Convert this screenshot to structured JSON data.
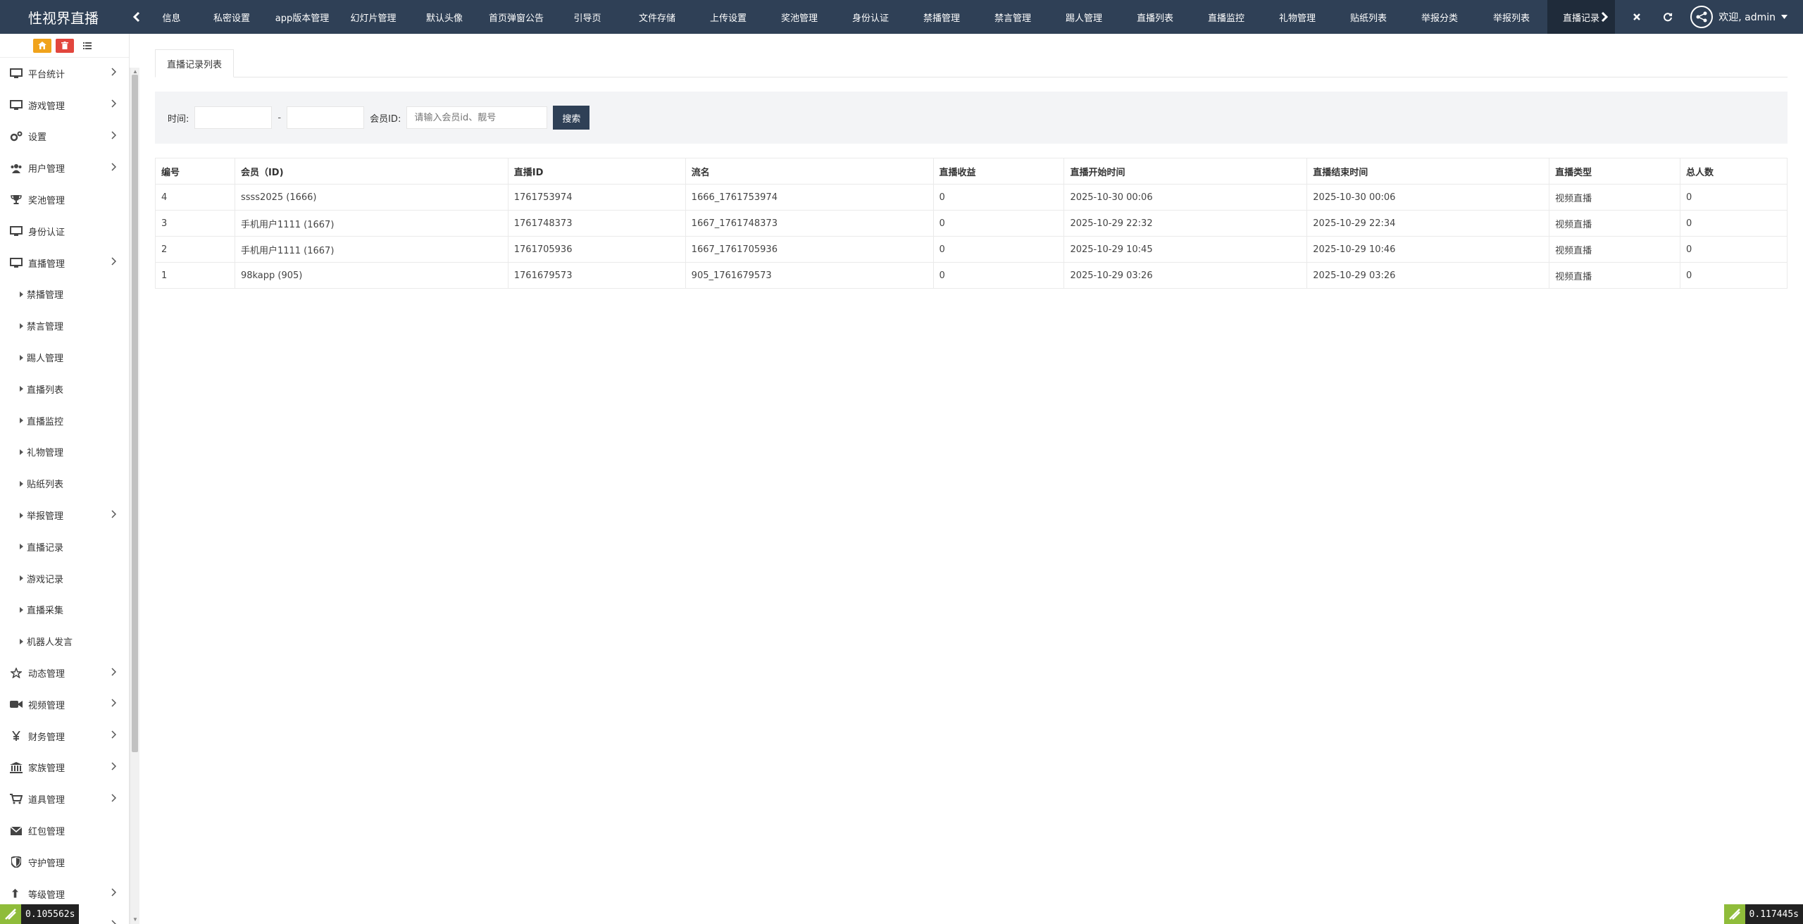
{
  "app": {
    "title": "性视界直播"
  },
  "topnav": [
    "信息",
    "私密设置",
    "app版本管理",
    "幻灯片管理",
    "默认头像",
    "首页弹窗公告",
    "引导页",
    "文件存储",
    "上传设置",
    "奖池管理",
    "身份认证",
    "禁播管理",
    "禁言管理",
    "踢人管理",
    "直播列表",
    "直播监控",
    "礼物管理",
    "贴纸列表",
    "举报分类",
    "举报列表",
    "直播记录"
  ],
  "topnav_active": "直播记录",
  "user": {
    "welcome": "欢迎, admin"
  },
  "sidebar": {
    "items": [
      {
        "label": "平台统计",
        "icon": "monitor-icon",
        "sub": false,
        "chevron": true
      },
      {
        "label": "游戏管理",
        "icon": "monitor-icon",
        "sub": false,
        "chevron": true
      },
      {
        "label": "设置",
        "icon": "cogs-icon",
        "sub": false,
        "chevron": true
      },
      {
        "label": "用户管理",
        "icon": "users-icon",
        "sub": false,
        "chevron": true
      },
      {
        "label": "奖池管理",
        "icon": "trophy-icon",
        "sub": false,
        "chevron": false
      },
      {
        "label": "身份认证",
        "icon": "monitor-icon",
        "sub": false,
        "chevron": false
      },
      {
        "label": "直播管理",
        "icon": "monitor-icon",
        "sub": false,
        "chevron": true,
        "expanded": true
      },
      {
        "label": "禁播管理",
        "icon": "caret-right-icon",
        "sub": true,
        "chevron": false
      },
      {
        "label": "禁言管理",
        "icon": "caret-right-icon",
        "sub": true,
        "chevron": false
      },
      {
        "label": "踢人管理",
        "icon": "caret-right-icon",
        "sub": true,
        "chevron": false
      },
      {
        "label": "直播列表",
        "icon": "caret-right-icon",
        "sub": true,
        "chevron": false
      },
      {
        "label": "直播监控",
        "icon": "caret-right-icon",
        "sub": true,
        "chevron": false
      },
      {
        "label": "礼物管理",
        "icon": "caret-right-icon",
        "sub": true,
        "chevron": false
      },
      {
        "label": "贴纸列表",
        "icon": "caret-right-icon",
        "sub": true,
        "chevron": false
      },
      {
        "label": "举报管理",
        "icon": "caret-right-icon",
        "sub": true,
        "chevron": true
      },
      {
        "label": "直播记录",
        "icon": "caret-right-icon",
        "sub": true,
        "chevron": false
      },
      {
        "label": "游戏记录",
        "icon": "caret-right-icon",
        "sub": true,
        "chevron": false
      },
      {
        "label": "直播采集",
        "icon": "caret-right-icon",
        "sub": true,
        "chevron": false
      },
      {
        "label": "机器人发言",
        "icon": "caret-right-icon",
        "sub": true,
        "chevron": false
      },
      {
        "label": "动态管理",
        "icon": "star-icon",
        "sub": false,
        "chevron": true
      },
      {
        "label": "视频管理",
        "icon": "video-camera-icon",
        "sub": false,
        "chevron": true
      },
      {
        "label": "财务管理",
        "icon": "yen-icon",
        "sub": false,
        "chevron": true
      },
      {
        "label": "家族管理",
        "icon": "bank-icon",
        "sub": false,
        "chevron": true
      },
      {
        "label": "道具管理",
        "icon": "cart-icon",
        "sub": false,
        "chevron": true
      },
      {
        "label": "红包管理",
        "icon": "envelope-icon",
        "sub": false,
        "chevron": false
      },
      {
        "label": "守护管理",
        "icon": "shield-icon",
        "sub": false,
        "chevron": false
      },
      {
        "label": "等级管理",
        "icon": "level-up-icon",
        "sub": false,
        "chevron": true
      },
      {
        "label": "",
        "icon": "",
        "sub": false,
        "chevron": true
      }
    ]
  },
  "main": {
    "tab_label": "直播记录列表",
    "filter": {
      "time_label": "时间:",
      "date_sep": "-",
      "start_date": "",
      "end_date": "",
      "member_label": "会员ID:",
      "member_placeholder": "请输入会员id、靓号",
      "search_label": "搜索"
    },
    "table": {
      "columns": [
        "编号",
        "会员（ID)",
        "直播ID",
        "流名",
        "直播收益",
        "直播开始时间",
        "直播结束时间",
        "直播类型",
        "总人数"
      ],
      "rows": [
        [
          "4",
          "ssss2025 (1666)",
          "1761753974",
          "1666_1761753974",
          "0",
          "2025-10-30 00:06",
          "2025-10-30 00:06",
          "视频直播",
          "0"
        ],
        [
          "3",
          "手机用户1111 (1667)",
          "1761748373",
          "1667_1761748373",
          "0",
          "2025-10-29 22:32",
          "2025-10-29 22:34",
          "视频直播",
          "0"
        ],
        [
          "2",
          "手机用户1111 (1667)",
          "1761705936",
          "1667_1761705936",
          "0",
          "2025-10-29 10:45",
          "2025-10-29 10:46",
          "视频直播",
          "0"
        ],
        [
          "1",
          "98kapp (905)",
          "1761679573",
          "905_1761679573",
          "0",
          "2025-10-29 03:26",
          "2025-10-29 03:26",
          "视频直播",
          "0"
        ]
      ]
    }
  },
  "debug": {
    "left_timer": "0.105562s",
    "right_timer": "0.117445s"
  },
  "colors": {
    "topbar": "#2f4056",
    "active_tab": "#1f2b3a",
    "btn_orange": "#f0a31c",
    "btn_red": "#e2463d",
    "filter_bg": "#f3f4f6"
  }
}
